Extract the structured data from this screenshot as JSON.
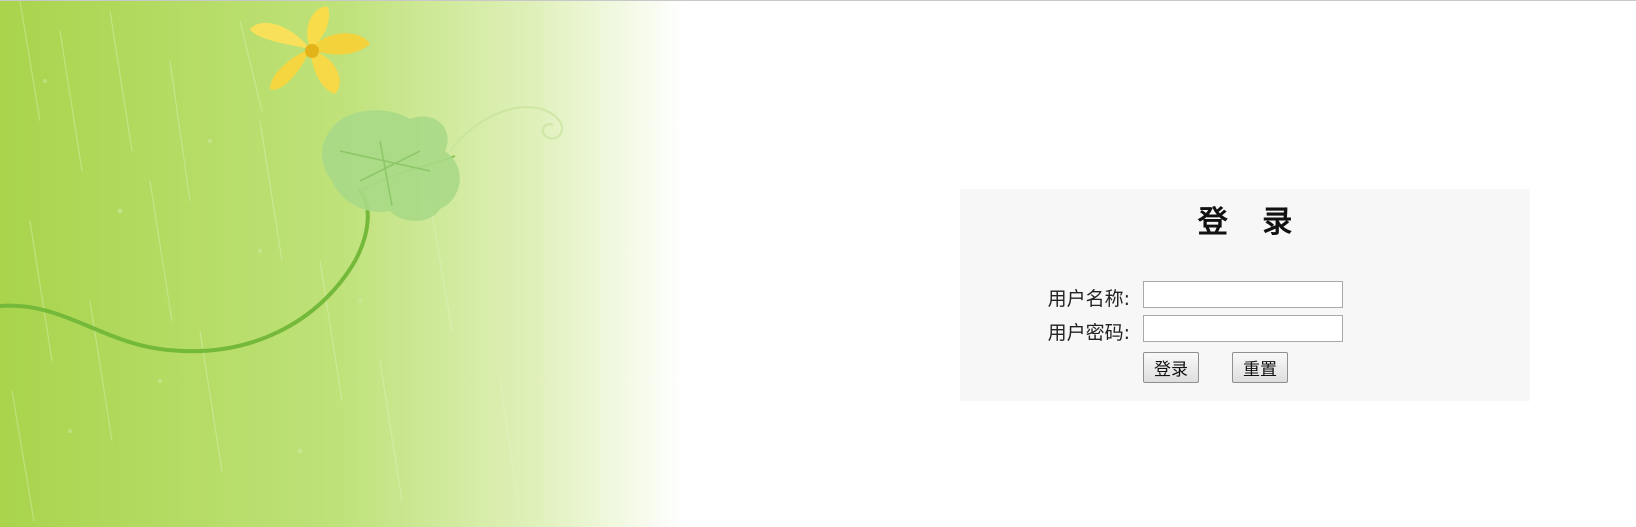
{
  "login": {
    "title": "登 录",
    "username_label": "用户名称:",
    "username_value": "",
    "password_label": "用户密码:",
    "password_value": "",
    "submit_label": "登录",
    "reset_label": "重置"
  },
  "decoration": {
    "background_icon": "cucumber-flower-vine-illustration",
    "flower_color": "#f7d94a",
    "leaf_color": "#9ed27a",
    "background_color": "#b9df66"
  }
}
